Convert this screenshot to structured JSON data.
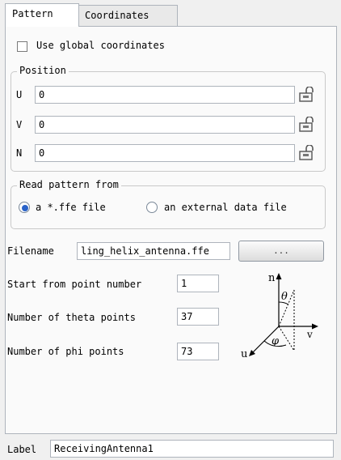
{
  "tabs": {
    "pattern": "Pattern",
    "coordinates": "Coordinates"
  },
  "use_global": {
    "label": "Use global coordinates",
    "checked": false
  },
  "position": {
    "title": "Position",
    "u_label": "U",
    "u_value": "0",
    "v_label": "V",
    "v_value": "0",
    "n_label": "N",
    "n_value": "0"
  },
  "read_pattern": {
    "title": "Read pattern from",
    "option_ffe": "a *.ffe file",
    "option_external": "an external data file",
    "selected": "option_ffe"
  },
  "filename": {
    "label": "Filename",
    "value": "ling_helix_antenna.ffe",
    "browse_label": "..."
  },
  "start_point": {
    "label": "Start from point number",
    "value": "1"
  },
  "theta_points": {
    "label": "Number of theta points",
    "value": "37"
  },
  "phi_points": {
    "label": "Number of phi points",
    "value": "73"
  },
  "diagram": {
    "n": "n",
    "u": "u",
    "v": "v",
    "theta": "θ",
    "phi": "φ"
  },
  "label_field": {
    "label": "Label",
    "value": "ReceivingAntenna1"
  },
  "colors": {
    "radio_selected": "#2a63c9",
    "panel_bg": "#fafafa",
    "window_bg": "#f0f0f0"
  }
}
